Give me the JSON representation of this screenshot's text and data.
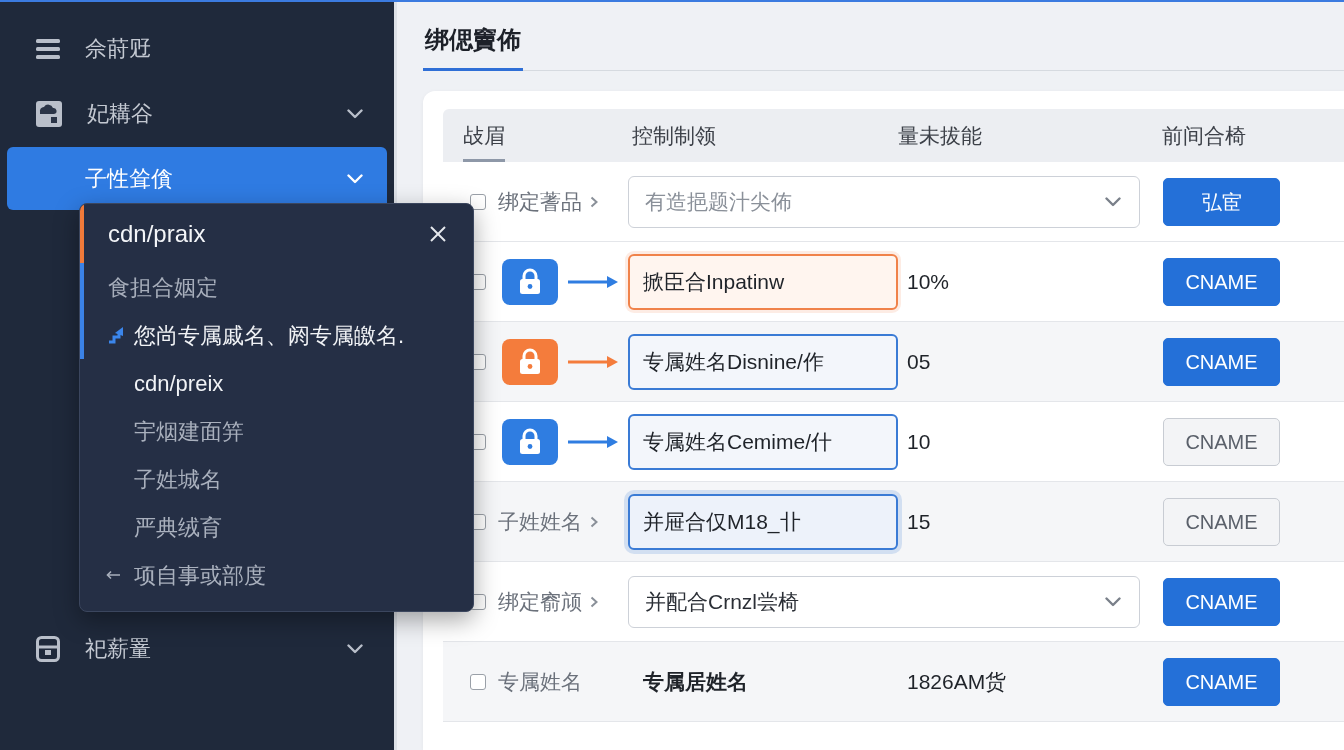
{
  "sidebar": {
    "items": [
      {
        "kind": "toggle",
        "label": "佘莳觃",
        "selected": false,
        "expandable": false
      },
      {
        "kind": "group",
        "label": "妃耩谷",
        "selected": false,
        "expandable": true
      },
      {
        "kind": "child",
        "label": "子性耸僋",
        "selected": true,
        "expandable": true
      },
      {
        "kind": "group",
        "label": "祀薪罿",
        "selected": false,
        "expandable": true
      }
    ]
  },
  "popup": {
    "title": "cdn/praix",
    "subtitle": "食担合姻定",
    "items": [
      {
        "kind": "link",
        "label": "您尚专属戚名、阏专属皦名.",
        "selected": true
      },
      {
        "kind": "plain",
        "label": "cdn/preix",
        "selected": true
      },
      {
        "kind": "plain",
        "label": "宇烟建面笄",
        "selected": false
      },
      {
        "kind": "plain",
        "label": "子姓城名",
        "selected": false
      },
      {
        "kind": "plain",
        "label": "严典绒育",
        "selected": false
      },
      {
        "kind": "back",
        "label": "项自事或部度",
        "selected": false
      }
    ]
  },
  "page": {
    "title": "绑偲竇佈"
  },
  "table": {
    "columns": [
      {
        "label": "敁眉",
        "selected": true
      },
      {
        "label": "控制制领",
        "selected": false
      },
      {
        "label": "量未拔能",
        "selected": false
      },
      {
        "label": "前间合椅",
        "selected": false
      }
    ],
    "rows": [
      {
        "kind": "select",
        "checked": false,
        "label": "绑定蓍品",
        "expandable": true,
        "select": {
          "placeholder": "有造挹题汁尖佈"
        },
        "button": {
          "label": "弘宦",
          "primary": true
        }
      },
      {
        "kind": "mapping",
        "checked": false,
        "icon": {
          "color": "#2f7de1"
        },
        "field": {
          "value": "掀臣合Inpatinw",
          "warning": true,
          "focused": false
        },
        "amount": "10%",
        "button": {
          "label": "CNAME",
          "primary": true
        }
      },
      {
        "kind": "mapping",
        "checked": false,
        "icon": {
          "color": "#f47c3c"
        },
        "field": {
          "value": "专属姓名Disnine/作",
          "warning": false,
          "focused": false
        },
        "amount": "05",
        "button": {
          "label": "CNAME",
          "primary": true
        }
      },
      {
        "kind": "mapping",
        "checked": false,
        "icon": {
          "color": "#2f7de1"
        },
        "field": {
          "value": "专属姓名Cemime/什",
          "warning": false,
          "focused": false
        },
        "amount": "10",
        "button": {
          "label": "CNAME",
          "primary": false
        }
      },
      {
        "kind": "input",
        "checked": false,
        "label": "子姓姓名",
        "expandable": true,
        "field": {
          "value": "并屉合仅M18_卝",
          "warning": false,
          "focused": true
        },
        "amount": "15",
        "button": {
          "label": "CNAME",
          "primary": false
        }
      },
      {
        "kind": "select",
        "checked": false,
        "label": "绑定窬颃",
        "expandable": true,
        "select": {
          "value": "并配合Crnzl尝椅"
        },
        "button": {
          "label": "CNAME",
          "primary": true
        }
      },
      {
        "kind": "text",
        "checked": false,
        "label": "专属姓名",
        "expandable": false,
        "text": "专属居姓名",
        "amount": "1826AM货",
        "button": {
          "label": "CNAME",
          "primary": true
        }
      }
    ]
  }
}
